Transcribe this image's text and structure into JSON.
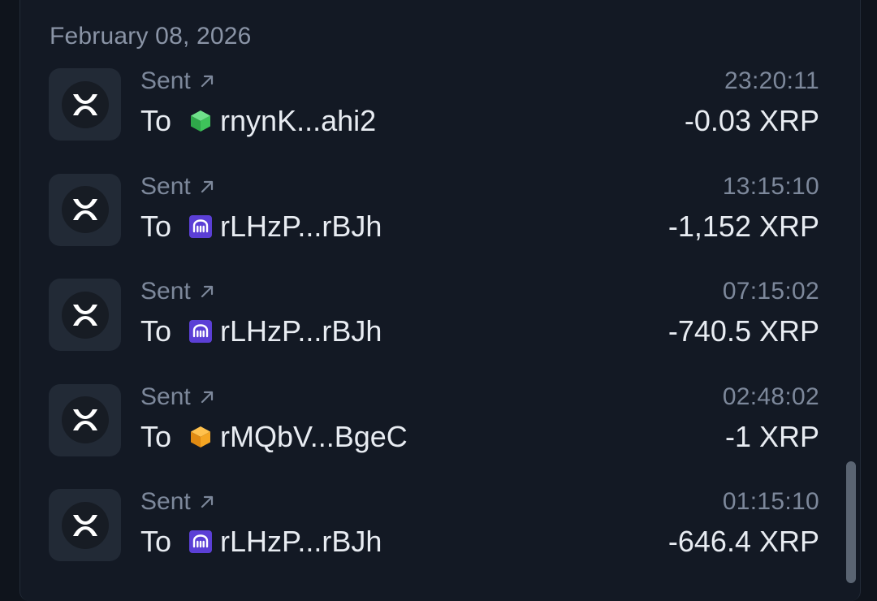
{
  "date_header": "February 08, 2026",
  "transactions": [
    {
      "type": "Sent",
      "to_label": "To",
      "address": "rnynK...ahi2",
      "service_icon": "green-cube-icon",
      "time": "23:20:11",
      "amount": "-0.03 XRP"
    },
    {
      "type": "Sent",
      "to_label": "To",
      "address": "rLHzP...rBJh",
      "service_icon": "kraken-icon",
      "time": "13:15:10",
      "amount": "-1,152 XRP"
    },
    {
      "type": "Sent",
      "to_label": "To",
      "address": "rLHzP...rBJh",
      "service_icon": "kraken-icon",
      "time": "07:15:02",
      "amount": "-740.5 XRP"
    },
    {
      "type": "Sent",
      "to_label": "To",
      "address": "rMQbV...BgeC",
      "service_icon": "orange-cube-icon",
      "time": "02:48:02",
      "amount": "-1 XRP"
    },
    {
      "type": "Sent",
      "to_label": "To",
      "address": "rLHzP...rBJh",
      "service_icon": "kraken-icon",
      "time": "01:15:10",
      "amount": "-646.4 XRP"
    }
  ],
  "colors": {
    "background": "#0f141c",
    "panel": "#131924",
    "muted_text": "#7d889b",
    "primary_text": "#e8ecf2",
    "kraken_purple": "#5b3fd6",
    "green_cube": "#3ec45a",
    "orange_cube": "#f5a623"
  }
}
